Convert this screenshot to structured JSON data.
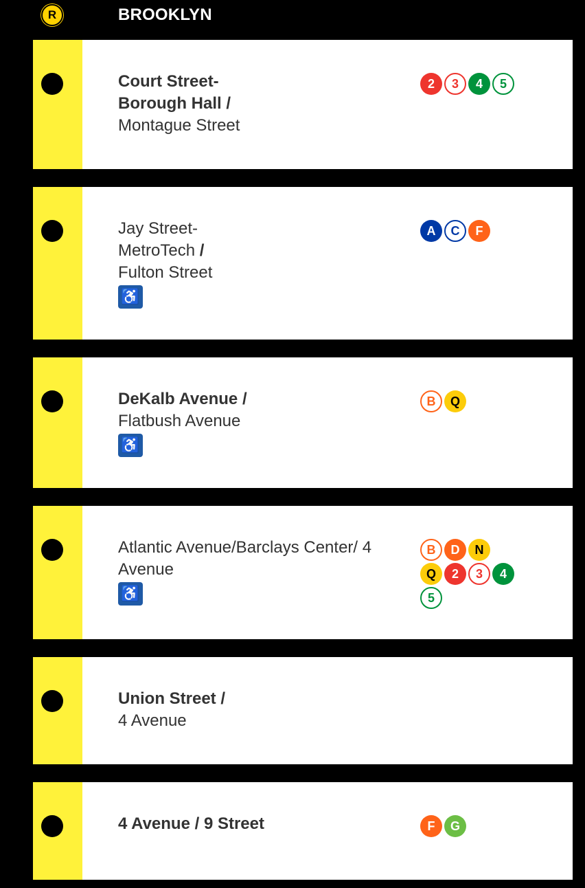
{
  "header": {
    "line": "R",
    "title": "BROOKLYN",
    "line_color": "#ffd200"
  },
  "stations": [
    {
      "name_bold": "Court Street-\nBorough Hall",
      "sep": "/",
      "name_regular": "Montague Street",
      "accessible": false,
      "routes": [
        {
          "label": "2",
          "style": "solid",
          "color": "#ee352e"
        },
        {
          "label": "3",
          "style": "open",
          "color": "#ee352e"
        },
        {
          "label": "4",
          "style": "solid",
          "color": "#00933c"
        },
        {
          "label": "5",
          "style": "open",
          "color": "#00933c"
        }
      ]
    },
    {
      "name_regular_pre": "Jay Street-\nMetroTech",
      "sep": "/",
      "name_regular": "Fulton Street",
      "accessible": true,
      "routes": [
        {
          "label": "A",
          "style": "solid",
          "color": "#0039a6"
        },
        {
          "label": "C",
          "style": "open",
          "color": "#0039a6"
        },
        {
          "label": "F",
          "style": "solid",
          "color": "#ff6319"
        }
      ]
    },
    {
      "name_bold": "DeKalb Avenue",
      "sep": "/",
      "name_regular": "Flatbush Avenue",
      "accessible": true,
      "routes": [
        {
          "label": "B",
          "style": "open",
          "color": "#ff6319"
        },
        {
          "label": "Q",
          "style": "solid",
          "color": "#fccc0a"
        }
      ]
    },
    {
      "name_regular_pre": "Atlantic Avenue/Barclays Center/ 4\nAvenue",
      "sep": "",
      "name_regular": "",
      "accessible": true,
      "routes": [
        {
          "label": "B",
          "style": "open",
          "color": "#ff6319"
        },
        {
          "label": "D",
          "style": "solid",
          "color": "#ff6319"
        },
        {
          "label": "N",
          "style": "solid",
          "color": "#fccc0a"
        },
        {
          "label": "Q",
          "style": "solid",
          "color": "#fccc0a"
        },
        {
          "label": "2",
          "style": "solid",
          "color": "#ee352e"
        },
        {
          "label": "3",
          "style": "open",
          "color": "#ee352e"
        },
        {
          "label": "4",
          "style": "solid",
          "color": "#00933c"
        },
        {
          "label": "5",
          "style": "open",
          "color": "#00933c"
        }
      ]
    },
    {
      "name_bold": "Union Street",
      "sep": "/",
      "name_regular": "4 Avenue",
      "accessible": false,
      "routes": []
    },
    {
      "name_bold": "4 Avenue",
      "sep": "/",
      "name_bold_post": "9 Street",
      "name_regular": "",
      "accessible": false,
      "routes": [
        {
          "label": "F",
          "style": "solid",
          "color": "#ff6319"
        },
        {
          "label": "G",
          "style": "solid",
          "color": "#6cbe45"
        }
      ]
    }
  ],
  "ada_icon": "wheelchair-icon",
  "ada_glyph": "♿"
}
